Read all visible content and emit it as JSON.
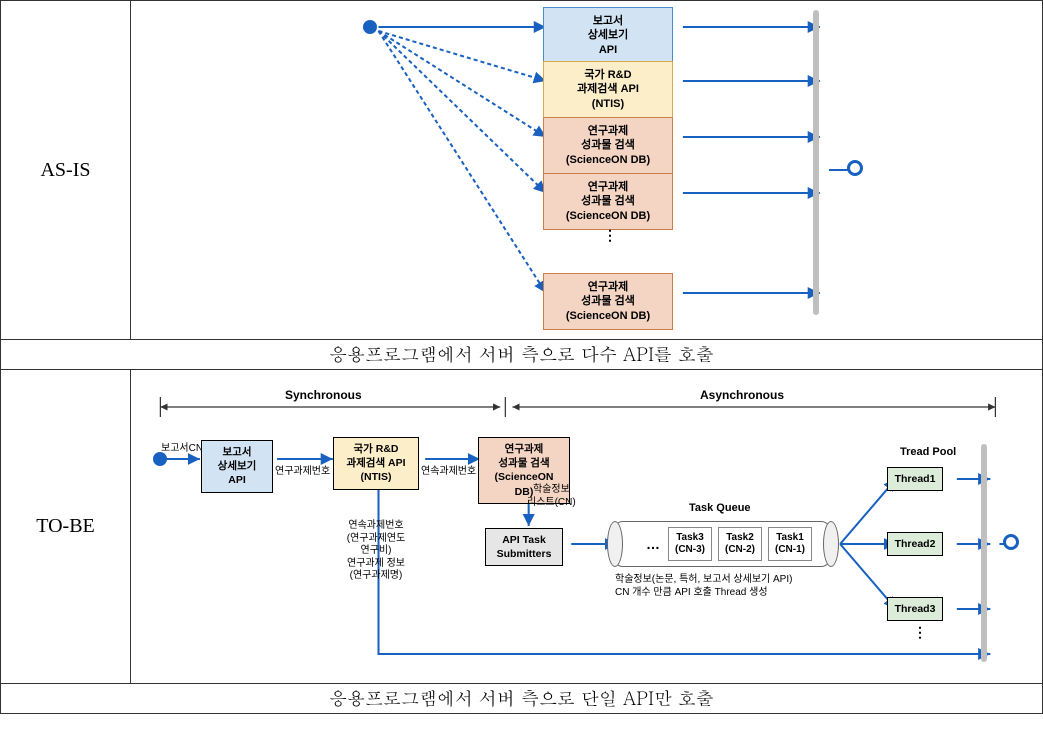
{
  "asis": {
    "label": "AS-IS",
    "boxes": [
      {
        "text": "보고서\n상세보기\nAPI",
        "kind": "blue"
      },
      {
        "text": "국가 R&D\n과제검색 API\n(NTIS)",
        "kind": "yellow"
      },
      {
        "text": "연구과제\n성과물 검색\n(ScienceON DB)",
        "kind": "orange"
      },
      {
        "text": "연구과제\n성과물 검색\n(ScienceON DB)",
        "kind": "orange"
      },
      {
        "text": "연구과제\n성과물 검색\n(ScienceON DB)",
        "kind": "orange"
      }
    ],
    "ellipsis": "⋮",
    "caption": "응용프로그램에서 서버 측으로 다수 API를 호출"
  },
  "tobe": {
    "label": "TO-BE",
    "sync_label": "Synchronous",
    "async_label": "Asynchronous",
    "start_label": "보고서CN",
    "seq_boxes": {
      "b1": "보고서\n상세보기\nAPI",
      "b2": "국가 R&D\n과제검색 API\n(NTIS)",
      "b3": "연구과제\n성과물 검색\n(ScienceON DB)"
    },
    "edge_labels": {
      "e1": "연구과제번호",
      "e2": "연속과제번호",
      "e3": "학술정보\n리스트(CN)",
      "ntis_down": "연속과제번호\n(연구과제연도\n연구비)\n연구과제 정보\n(연구과제명)"
    },
    "api_submitters": "API Task\nSubmitters",
    "queue_title": "Task Queue",
    "tasks": [
      {
        "label": "Task3\n(CN-3)"
      },
      {
        "label": "Task2\n(CN-2)"
      },
      {
        "label": "Task1\n(CN-1)"
      }
    ],
    "queue_note": "학술정보(논문, 특허, 보고서 상세보기 API)\nCN 개수 만큼 API 호출 Thread 생성",
    "thread_pool_label": "Tread Pool",
    "threads": [
      "Thread1",
      "Thread2",
      "Thread3"
    ],
    "ellipsis_h": "…",
    "ellipsis_v": "⋮",
    "caption": "응용프로그램에서 서버 측으로 단일 API만 호출"
  }
}
